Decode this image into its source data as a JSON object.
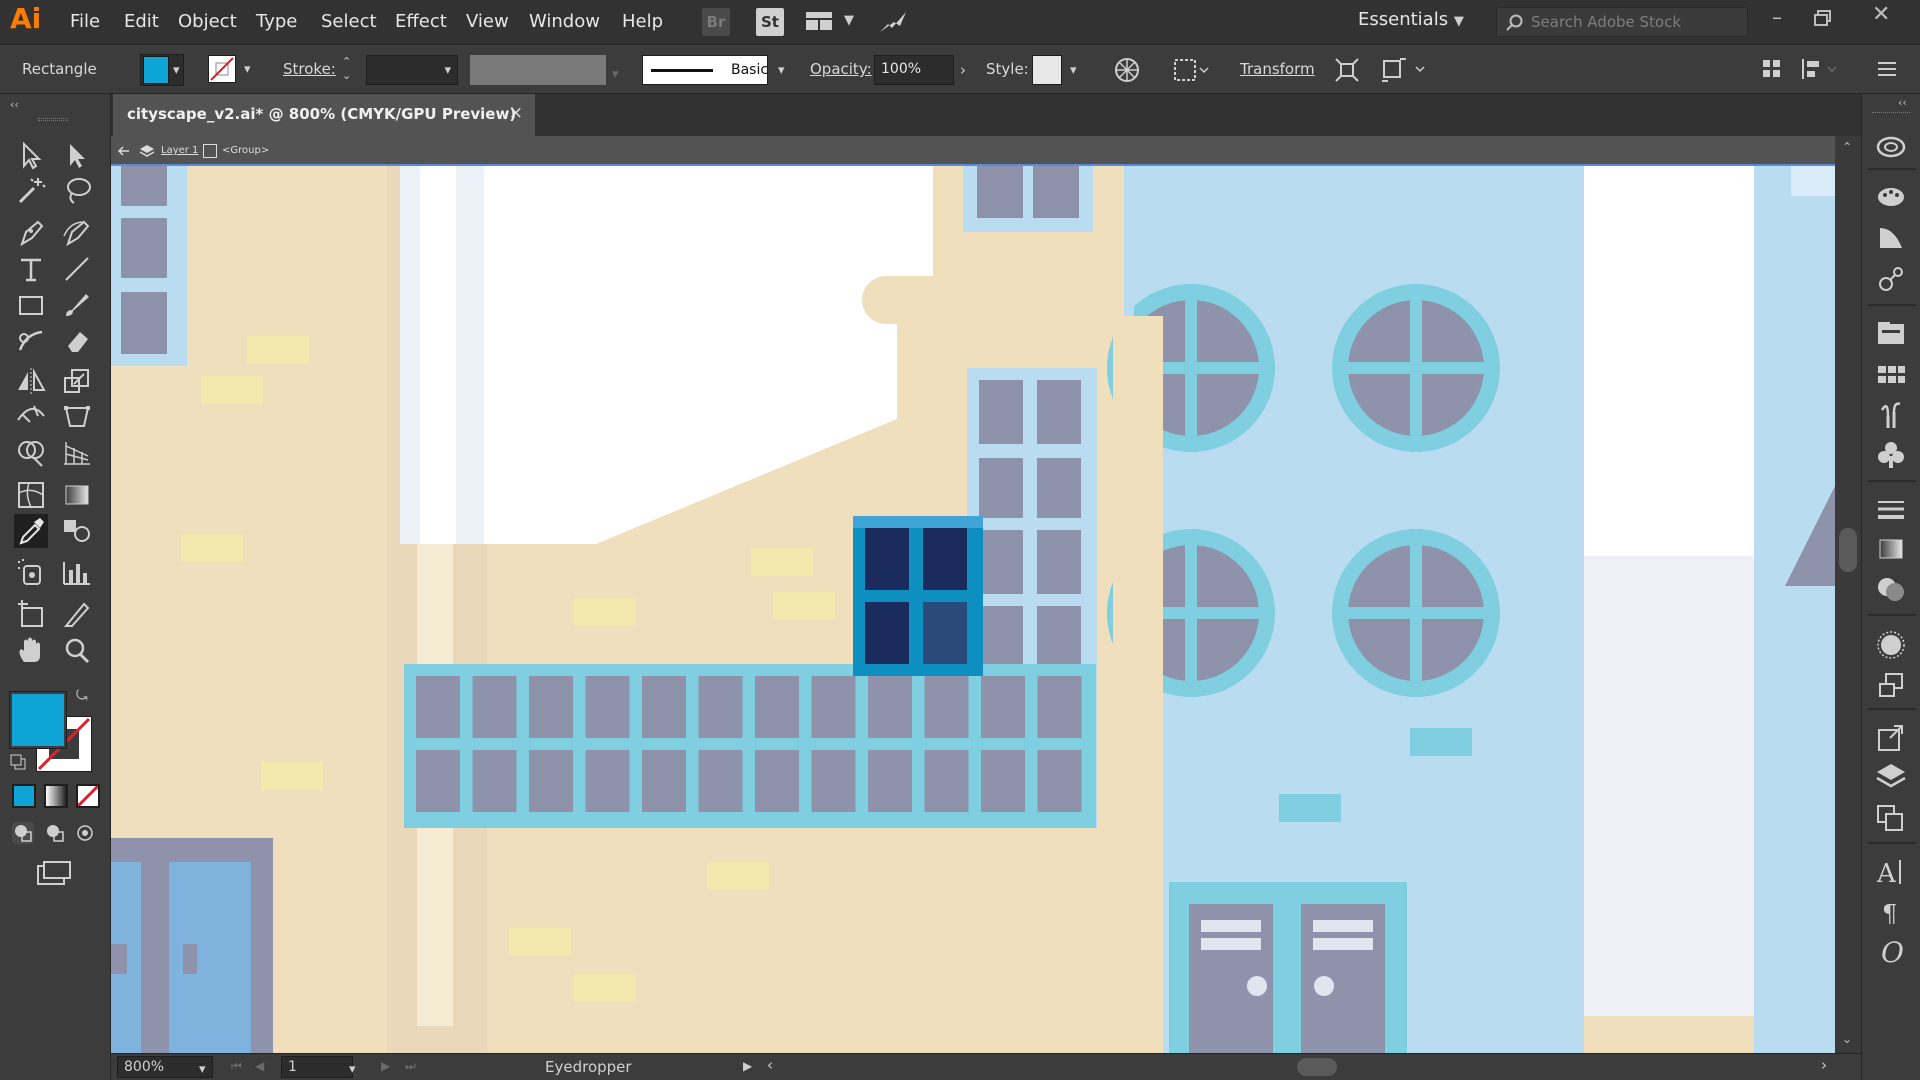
{
  "app": {
    "logo": "Ai",
    "menu": [
      "File",
      "Edit",
      "Object",
      "Type",
      "Select",
      "Effect",
      "View",
      "Window",
      "Help"
    ],
    "bridge_button": "Br",
    "stock_button": "St",
    "workspace": "Essentials",
    "search_placeholder": "Search Adobe Stock"
  },
  "control_bar": {
    "selection_type": "Rectangle",
    "fill_color": "#0ea5d6",
    "stroke_label": "Stroke:",
    "stroke_weight": "",
    "brush_definition": "",
    "stroke_profile": "Basic",
    "opacity_label": "Opacity:",
    "opacity_value": "100%",
    "style_label": "Style:",
    "transform_label": "Transform"
  },
  "document": {
    "tab_title": "cityscape_v2.ai* @ 800% (CMYK/GPU Preview)",
    "close_glyph": "×",
    "breadcrumb_layer": "Layer 1",
    "breadcrumb_group": "<Group>"
  },
  "status_bar": {
    "zoom": "800%",
    "artboard": "1",
    "current_tool": "Eyedropper"
  },
  "colors": {
    "accent_fill": "#0ea5d6",
    "canvas_building_beige": "#f0dfbc",
    "canvas_building_blue": "#b9dcf1",
    "window_frame": "#7fcfe0",
    "window_pane": "#8e93ab",
    "selected_window_pane": "#1b2b5e"
  },
  "tools": [
    "selection-tool",
    "direct-selection-tool",
    "magic-wand-tool",
    "lasso-tool",
    "pen-tool",
    "curvature-tool",
    "type-tool",
    "line-tool",
    "rectangle-tool",
    "paintbrush-tool",
    "shaper-tool",
    "eraser-tool",
    "reflect-tool",
    "scale-tool",
    "width-tool",
    "free-transform-tool",
    "shape-builder-tool",
    "perspective-grid-tool",
    "mesh-tool",
    "gradient-tool",
    "eyedropper-tool",
    "blend-tool",
    "symbol-sprayer-tool",
    "column-graph-tool",
    "artboard-tool",
    "slice-tool",
    "hand-tool",
    "zoom-tool"
  ],
  "right_panels": [
    "cc-libraries-icon",
    "color-guide-icon",
    "color-icon",
    "artboards-icon",
    "asset-export-icon",
    "swatches-icon",
    "brushes-icon",
    "symbols-icon",
    "stroke-icon",
    "gradient-icon",
    "transparency-icon",
    "appearance-icon",
    "graphic-styles-icon",
    "export-icon",
    "layers-icon",
    "transform-icon",
    "character-icon",
    "paragraph-icon",
    "opentype-icon"
  ]
}
